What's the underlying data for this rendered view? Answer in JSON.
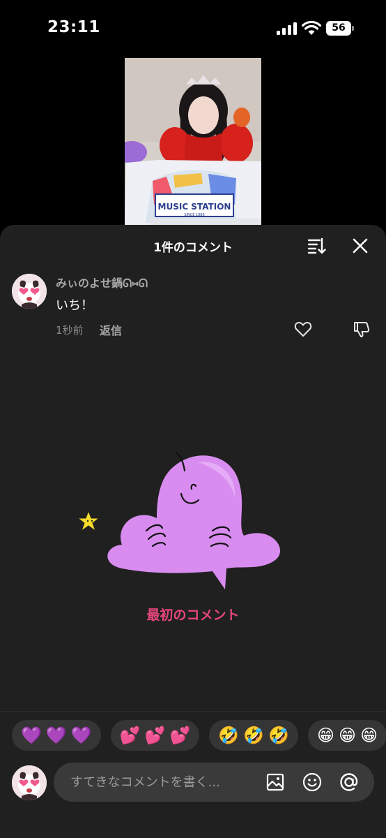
{
  "status_bar": {
    "time": "23:11",
    "battery": "56"
  },
  "sheet": {
    "title": "1件のコメント"
  },
  "comment": {
    "username": "みぃのよせ鍋ᘏ⑅ᘏ",
    "text": "いち！",
    "timestamp": "1秒前",
    "reply_label": "返信"
  },
  "empty_state": {
    "label": "最初のコメント"
  },
  "emoji_suggestions": [
    [
      "💜",
      "💜",
      "💜"
    ],
    [
      "💕",
      "💕",
      "💕"
    ],
    [
      "🤣",
      "🤣",
      "🤣"
    ],
    [
      "😁",
      "😁",
      "😁"
    ]
  ],
  "composer": {
    "placeholder": "すてきなコメントを書く..."
  },
  "colors": {
    "accent": "#e5457c",
    "sheet_bg": "#202020",
    "chip_bg": "#353535"
  }
}
